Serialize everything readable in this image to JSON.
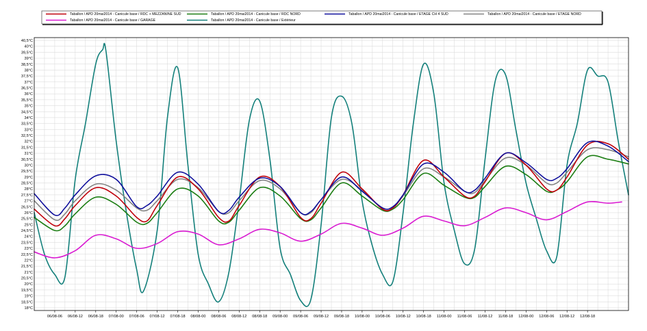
{
  "chart_data": {
    "type": "line",
    "title": "",
    "xlabel": "",
    "ylabel": "",
    "ylim": [
      18,
      40.5
    ],
    "y_ticks": [
      "18°C",
      "18,5°C",
      "19°C",
      "19,5°C",
      "20°C",
      "20,5°C",
      "21°C",
      "21,5°C",
      "22°C",
      "22,5°C",
      "23°C",
      "23,5°C",
      "24°C",
      "24,5°C",
      "25°C",
      "25,5°C",
      "26°C",
      "26,5°C",
      "27°C",
      "27,5°C",
      "28°C",
      "28,5°C",
      "29°C",
      "29,5°C",
      "30°C",
      "30,5°C",
      "31°C",
      "31,5°C",
      "32°C",
      "32,5°C",
      "33°C",
      "33,5°C",
      "34°C",
      "34,5°C",
      "35°C",
      "35,5°C",
      "36°C",
      "36,5°C",
      "37°C",
      "37,5°C",
      "38°C",
      "38,5°C",
      "39°C",
      "39,5°C",
      "40°C",
      "40,5°C"
    ],
    "x_range_hours": [
      0,
      174
    ],
    "x_ticks": [
      {
        "hour": 6,
        "label": "06/08-06"
      },
      {
        "hour": 12,
        "label": "06/08-12"
      },
      {
        "hour": 18,
        "label": "06/08-18"
      },
      {
        "hour": 24,
        "label": "07/08-00"
      },
      {
        "hour": 30,
        "label": "07/08-06"
      },
      {
        "hour": 36,
        "label": "07/08-12"
      },
      {
        "hour": 42,
        "label": "07/08-18"
      },
      {
        "hour": 48,
        "label": "08/08-00"
      },
      {
        "hour": 54,
        "label": "08/08-06"
      },
      {
        "hour": 60,
        "label": "08/08-12"
      },
      {
        "hour": 66,
        "label": "08/08-18"
      },
      {
        "hour": 72,
        "label": "09/08-00"
      },
      {
        "hour": 78,
        "label": "09/08-06"
      },
      {
        "hour": 84,
        "label": "09/08-12"
      },
      {
        "hour": 90,
        "label": "09/08-18"
      },
      {
        "hour": 96,
        "label": "10/08-00"
      },
      {
        "hour": 102,
        "label": "10/08-06"
      },
      {
        "hour": 108,
        "label": "10/08-12"
      },
      {
        "hour": 114,
        "label": "10/08-18"
      },
      {
        "hour": 120,
        "label": "11/08-00"
      },
      {
        "hour": 126,
        "label": "11/08-06"
      },
      {
        "hour": 132,
        "label": "11/08-12"
      },
      {
        "hour": 138,
        "label": "11/08-18"
      },
      {
        "hour": 144,
        "label": "12/08-00"
      },
      {
        "hour": 150,
        "label": "12/08-06"
      },
      {
        "hour": 156,
        "label": "12/08-12"
      },
      {
        "hour": 162,
        "label": "12/08-18"
      }
    ],
    "grid": true,
    "legend_position": "top",
    "series": [
      {
        "name": "Taballon  /  APD 20mai2014 - Canicule base / RDC + MEZZANINE SUD",
        "color": "#c0000a",
        "x": [
          0,
          6,
          9,
          12,
          18,
          24,
          30,
          33,
          36,
          42,
          48,
          54,
          57,
          60,
          66,
          72,
          78,
          81,
          84,
          90,
          96,
          102,
          105,
          108,
          114,
          120,
          126,
          129,
          132,
          138,
          144,
          150,
          153,
          156,
          162,
          168,
          174
        ],
        "y": [
          26.3,
          24.9,
          25.5,
          26.6,
          28.1,
          27.4,
          25.6,
          25.3,
          26.6,
          29.0,
          28.0,
          25.6,
          25.3,
          26.6,
          29.0,
          28.2,
          25.6,
          25.5,
          26.8,
          29.4,
          28.0,
          26.3,
          26.4,
          27.5,
          30.4,
          29.0,
          27.4,
          27.4,
          28.6,
          31.0,
          30.0,
          28.0,
          27.9,
          29.0,
          31.7,
          31.8,
          30.5
        ]
      },
      {
        "name": "Taballon  /  APD 20mai2014 - Canicule base / RDC NORD",
        "color": "#1b7d12",
        "x": [
          0,
          6,
          9,
          12,
          18,
          24,
          30,
          33,
          36,
          42,
          48,
          54,
          57,
          60,
          66,
          72,
          78,
          81,
          84,
          90,
          96,
          102,
          105,
          108,
          114,
          120,
          126,
          129,
          132,
          138,
          144,
          150,
          153,
          156,
          162,
          168,
          174
        ],
        "y": [
          25.6,
          24.5,
          24.9,
          25.9,
          27.3,
          26.7,
          25.2,
          25.1,
          26.0,
          28.0,
          27.4,
          25.3,
          25.2,
          26.2,
          28.1,
          27.4,
          25.5,
          25.4,
          26.4,
          28.5,
          27.4,
          26.2,
          26.3,
          27.1,
          29.3,
          28.3,
          27.3,
          27.3,
          28.2,
          29.9,
          29.2,
          27.8,
          27.9,
          28.6,
          30.7,
          30.5,
          30.1
        ]
      },
      {
        "name": "Taballon  /  APD 20mai2014 - Canicule base / ETAGE CH 4 SUD",
        "color": "#10109c",
        "x": [
          0,
          6,
          9,
          12,
          18,
          24,
          30,
          33,
          36,
          42,
          48,
          54,
          57,
          60,
          66,
          72,
          78,
          81,
          84,
          90,
          96,
          102,
          105,
          108,
          114,
          120,
          126,
          129,
          132,
          138,
          144,
          150,
          153,
          156,
          162,
          168,
          174
        ],
        "y": [
          27.6,
          25.8,
          26.4,
          27.5,
          29.1,
          28.8,
          26.5,
          26.6,
          27.4,
          29.4,
          28.4,
          26.1,
          26.2,
          27.3,
          28.9,
          28.2,
          26.0,
          26.1,
          27.1,
          29.0,
          27.8,
          26.4,
          26.5,
          27.5,
          30.1,
          29.4,
          27.8,
          27.9,
          28.9,
          31.0,
          30.2,
          28.8,
          28.9,
          29.7,
          31.9,
          31.6,
          30.3
        ]
      },
      {
        "name": "Taballon  /  APD 20mai2014 - Canicule base / ETAGE NORD",
        "color": "#838383",
        "x": [
          0,
          6,
          9,
          12,
          18,
          24,
          30,
          33,
          36,
          42,
          48,
          54,
          57,
          60,
          66,
          72,
          78,
          81,
          84,
          90,
          96,
          102,
          105,
          108,
          114,
          120,
          126,
          129,
          132,
          138,
          144,
          150,
          153,
          156,
          162,
          168,
          174
        ],
        "y": [
          27.0,
          25.4,
          25.9,
          27.0,
          28.4,
          27.9,
          26.4,
          26.2,
          27.0,
          28.8,
          28.1,
          26.1,
          26.0,
          27.0,
          28.7,
          28.0,
          26.0,
          26.0,
          27.1,
          28.8,
          27.9,
          26.3,
          26.4,
          27.4,
          29.7,
          29.0,
          27.8,
          27.7,
          28.7,
          30.6,
          30.0,
          28.5,
          28.5,
          29.4,
          31.3,
          31.3,
          30.7
        ]
      },
      {
        "name": "Taballon  /  APD 20mai2014 - Canicule base / GARAGE",
        "color": "#d91ad1",
        "x": [
          0,
          6,
          12,
          18,
          24,
          30,
          36,
          42,
          48,
          54,
          60,
          66,
          72,
          78,
          84,
          90,
          96,
          102,
          108,
          114,
          120,
          126,
          132,
          138,
          144,
          150,
          156,
          162,
          168,
          172
        ],
        "y": [
          22.7,
          22.2,
          22.8,
          24.1,
          23.8,
          23.0,
          23.4,
          24.4,
          24.2,
          23.3,
          23.8,
          24.6,
          24.3,
          23.6,
          24.2,
          25.1,
          24.7,
          24.1,
          24.7,
          25.7,
          25.3,
          24.9,
          25.6,
          26.4,
          26.0,
          25.4,
          26.1,
          26.9,
          26.8,
          26.9
        ]
      },
      {
        "name": "Taballon  /  APD 20mai2014 - Canicule base / Extérieur",
        "color": "#127f7a",
        "x": [
          0,
          3,
          6,
          9,
          12,
          15,
          18,
          20,
          21,
          24,
          27,
          30,
          32,
          36,
          39,
          42,
          45,
          48,
          51,
          54,
          57,
          60,
          63,
          66,
          69,
          72,
          75,
          78,
          81,
          84,
          87,
          90,
          93,
          96,
          99,
          102,
          105,
          108,
          111,
          114,
          117,
          120,
          123,
          126,
          129,
          132,
          135,
          138,
          141,
          144,
          147,
          150,
          153,
          156,
          159,
          162,
          165,
          168,
          171,
          174
        ],
        "y": [
          26.0,
          22.5,
          20.8,
          20.6,
          28.8,
          33.5,
          38.5,
          39.7,
          39.6,
          32.0,
          26.0,
          21.2,
          19.4,
          24.5,
          34.0,
          38.2,
          30.0,
          22.5,
          20.0,
          18.5,
          21.0,
          27.0,
          33.8,
          35.4,
          30.5,
          23.0,
          20.8,
          18.6,
          18.7,
          25.0,
          34.0,
          35.8,
          33.5,
          27.0,
          23.2,
          20.8,
          20.2,
          26.0,
          33.5,
          38.5,
          36.0,
          28.5,
          24.5,
          21.7,
          23.0,
          30.5,
          37.1,
          37.6,
          33.0,
          28.5,
          25.5,
          22.8,
          22.3,
          30.0,
          33.5,
          38.0,
          37.5,
          37.0,
          32.0,
          27.5
        ]
      }
    ]
  }
}
